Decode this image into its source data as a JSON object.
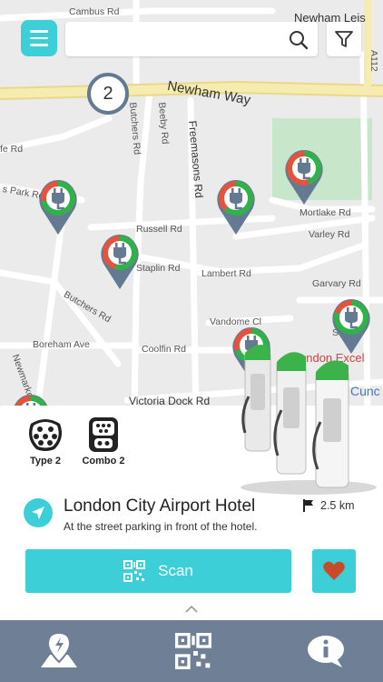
{
  "search": {
    "placeholder": "",
    "value": ""
  },
  "map": {
    "streets": {
      "cambus_rd": "Cambus Rd",
      "newham_leis": "Newham Leis",
      "a112": "A112",
      "newham_way": "Newham Way",
      "butchers_rd_top": "Butchers Rd",
      "beeby_rd": "Beeby Rd",
      "freemasons_rd": "Freemasons Rd",
      "fe_rd": "fe Rd",
      "s_park_rd": "s Park Rd",
      "russell_rd": "Russell Rd",
      "mortlake_rd": "Mortlake Rd",
      "varley_rd": "Varley Rd",
      "staplin_rd": "Staplin Rd",
      "lambert_rd": "Lambert Rd",
      "garvary_rd": "Garvary Rd",
      "butchers_rd": "Butchers Rd",
      "vandome_cl": "Vandome Cl",
      "boreham_ave": "Boreham Ave",
      "coolfin_rd": "Coolfin Rd",
      "victoria_dock_rd": "Victoria Dock Rd",
      "newmarket_rd": "Newmarket Rd",
      "cunc": "Cunc",
      "excel": "ondon Excel",
      "sh": "Sh"
    },
    "cluster_count": "2"
  },
  "connectors": [
    {
      "label": "Type 2",
      "icon": "type2-connector-icon"
    },
    {
      "label": "Combo 2",
      "icon": "combo2-connector-icon"
    }
  ],
  "location": {
    "title": "London City Airport Hotel",
    "subtitle": "At the street parking in front of the hotel.",
    "distance": "2.5 km"
  },
  "actions": {
    "scan_label": "Scan"
  },
  "tabs": [
    {
      "name": "map-tab",
      "icon": "map-pin-icon"
    },
    {
      "name": "qr-tab",
      "icon": "qr-code-icon"
    },
    {
      "name": "info-tab",
      "icon": "info-icon"
    }
  ],
  "colors": {
    "accent": "#3dcfd8",
    "tabbar": "#6e7f96",
    "pin": "#647a93",
    "available": "#2db34a",
    "busy": "#e5533d",
    "heart": "#c94a2a"
  }
}
